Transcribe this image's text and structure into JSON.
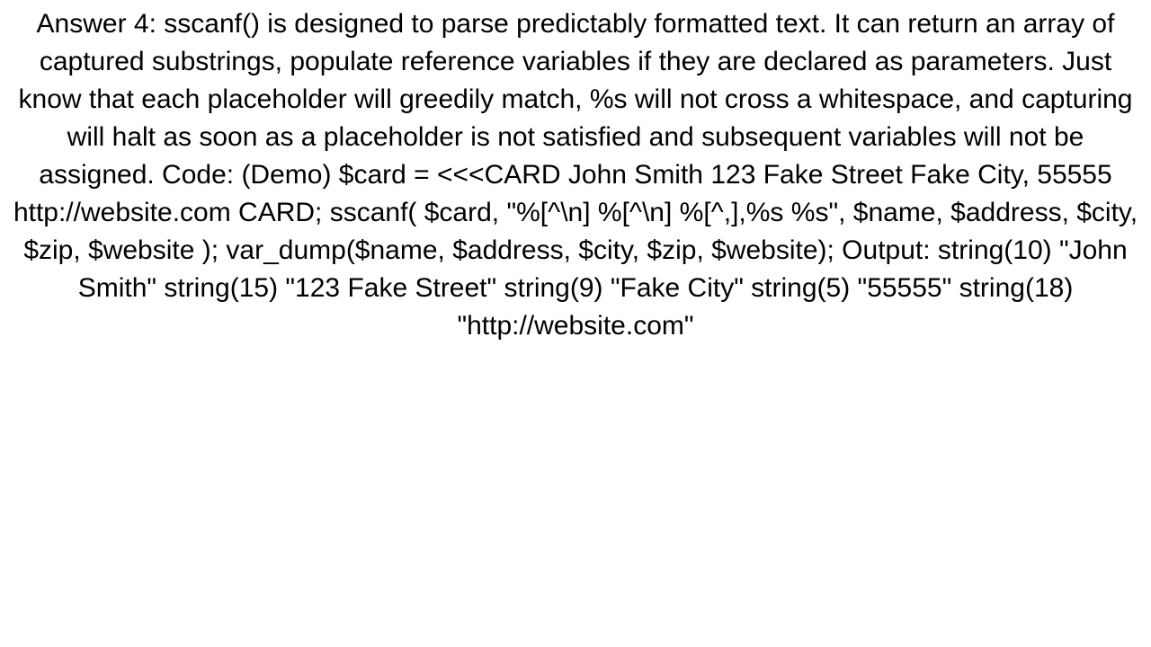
{
  "document": {
    "text": "Answer 4: sscanf() is designed to parse predictably formatted text.  It can return an array of captured substrings, populate reference variables if they are declared as parameters. Just know that each placeholder will greedily match, %s will not cross a whitespace, and capturing will halt as soon as a placeholder is not satisfied and subsequent variables will not be assigned.  Code: (Demo) $card = <<<CARD John Smith 123 Fake Street Fake City, 55555 http://website.com CARD;  sscanf(     $card,     \"%[^\\n]     %[^\\n]     %[^,],%s     %s\",     $name,     $address,     $city,     $zip,     $website );  var_dump($name, $address, $city, $zip, $website);  Output:  string(10) \"John Smith\" string(15) \"123 Fake Street\" string(9) \"Fake City\" string(5) \"55555\" string(18) \"http://website.com\""
  }
}
